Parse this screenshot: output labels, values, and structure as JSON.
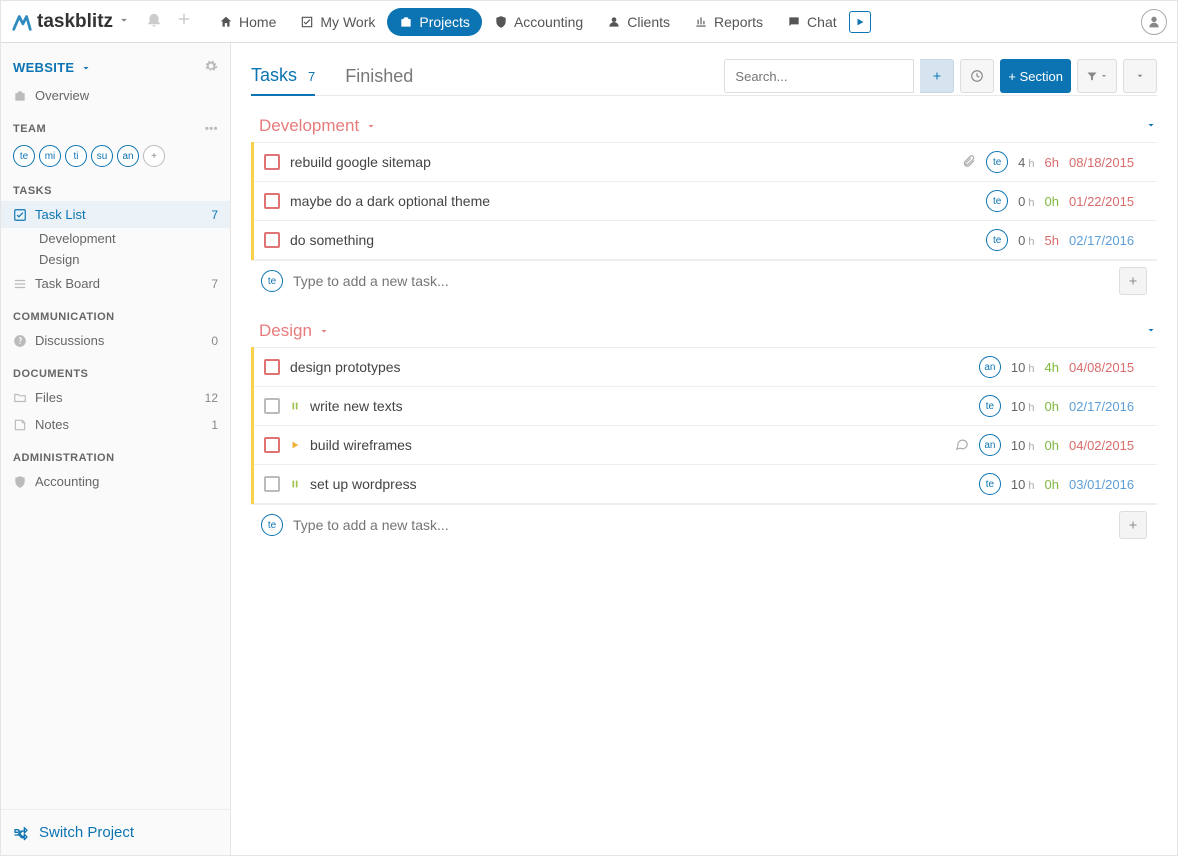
{
  "logo": "taskblitz",
  "topnav": {
    "home": "Home",
    "mywork": "My Work",
    "projects": "Projects",
    "accounting": "Accounting",
    "clients": "Clients",
    "reports": "Reports",
    "chat": "Chat"
  },
  "sidebar": {
    "project": "WEBSITE",
    "overview": "Overview",
    "team_head": "TEAM",
    "team": [
      "te",
      "mi",
      "ti",
      "su",
      "an"
    ],
    "tasks_head": "TASKS",
    "tasklist": {
      "label": "Task List",
      "count": "7"
    },
    "subs": [
      "Development",
      "Design"
    ],
    "taskboard": {
      "label": "Task Board",
      "count": "7"
    },
    "comm_head": "COMMUNICATION",
    "discussions": {
      "label": "Discussions",
      "count": "0"
    },
    "docs_head": "DOCUMENTS",
    "files": {
      "label": "Files",
      "count": "12"
    },
    "notes": {
      "label": "Notes",
      "count": "1"
    },
    "admin_head": "ADMINISTRATION",
    "accounting": "Accounting",
    "switch": "Switch Project"
  },
  "main": {
    "tab_tasks": "Tasks",
    "tab_tasks_count": "7",
    "tab_finished": "Finished",
    "search_placeholder": "Search...",
    "section_btn": "+ Section",
    "add_task_placeholder": "Type to add a new task...",
    "sections": [
      {
        "title": "Development",
        "tasks": [
          {
            "name": "rebuild google sitemap",
            "cbox": "red",
            "status": "",
            "attach": true,
            "comment": false,
            "asg": "te",
            "est_n": "4",
            "est_u": "h",
            "act_n": "6h",
            "act_cls": "red",
            "date": "08/18/2015",
            "date_cls": "red"
          },
          {
            "name": "maybe do a dark optional theme",
            "cbox": "red",
            "status": "",
            "attach": false,
            "comment": false,
            "asg": "te",
            "est_n": "0",
            "est_u": "h",
            "act_n": "0h",
            "act_cls": "green",
            "date": "01/22/2015",
            "date_cls": "red"
          },
          {
            "name": "do something",
            "cbox": "red",
            "status": "",
            "attach": false,
            "comment": false,
            "asg": "te",
            "est_n": "0",
            "est_u": "h",
            "act_n": "5h",
            "act_cls": "red",
            "date": "02/17/2016",
            "date_cls": ""
          }
        ],
        "add_asg": "te"
      },
      {
        "title": "Design",
        "tasks": [
          {
            "name": "design prototypes",
            "cbox": "red",
            "status": "",
            "attach": false,
            "comment": false,
            "asg": "an",
            "est_n": "10",
            "est_u": "h",
            "act_n": "4h",
            "act_cls": "green",
            "date": "04/08/2015",
            "date_cls": "red"
          },
          {
            "name": "write new texts",
            "cbox": "gray",
            "status": "pause",
            "attach": false,
            "comment": false,
            "asg": "te",
            "est_n": "10",
            "est_u": "h",
            "act_n": "0h",
            "act_cls": "green",
            "date": "02/17/2016",
            "date_cls": ""
          },
          {
            "name": "build wireframes",
            "cbox": "red",
            "status": "play",
            "attach": false,
            "comment": true,
            "asg": "an",
            "est_n": "10",
            "est_u": "h",
            "act_n": "0h",
            "act_cls": "green",
            "date": "04/02/2015",
            "date_cls": "red"
          },
          {
            "name": "set up wordpress",
            "cbox": "gray",
            "status": "pause",
            "attach": false,
            "comment": false,
            "asg": "te",
            "est_n": "10",
            "est_u": "h",
            "act_n": "0h",
            "act_cls": "green",
            "date": "03/01/2016",
            "date_cls": ""
          }
        ],
        "add_asg": "te"
      }
    ]
  }
}
